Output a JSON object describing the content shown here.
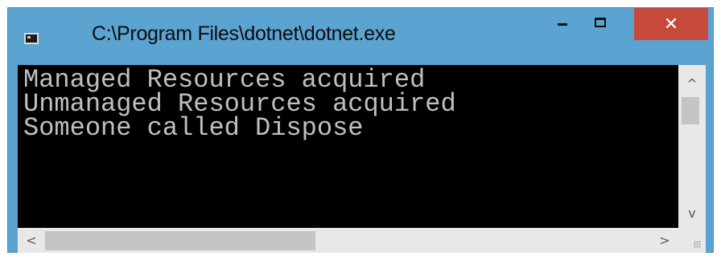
{
  "window": {
    "title": "C:\\Program Files\\dotnet\\dotnet.exe",
    "controls": {
      "minimize_icon": "minimize-icon",
      "maximize_icon": "maximize-icon",
      "close_label": "✕"
    },
    "colors": {
      "frame": "#5ba3d0",
      "close": "#c7493a",
      "console_bg": "#000000",
      "console_text": "#c0c0c0",
      "scrollbar": "#e8e8e8"
    }
  },
  "console": {
    "lines": [
      "Managed Resources acquired",
      "Unmanaged Resources acquired",
      "Someone called Dispose"
    ]
  },
  "scrollbars": {
    "vertical": {
      "up_glyph": "^",
      "down_glyph": "v"
    },
    "horizontal": {
      "left_glyph": "<",
      "right_glyph": ">"
    }
  }
}
